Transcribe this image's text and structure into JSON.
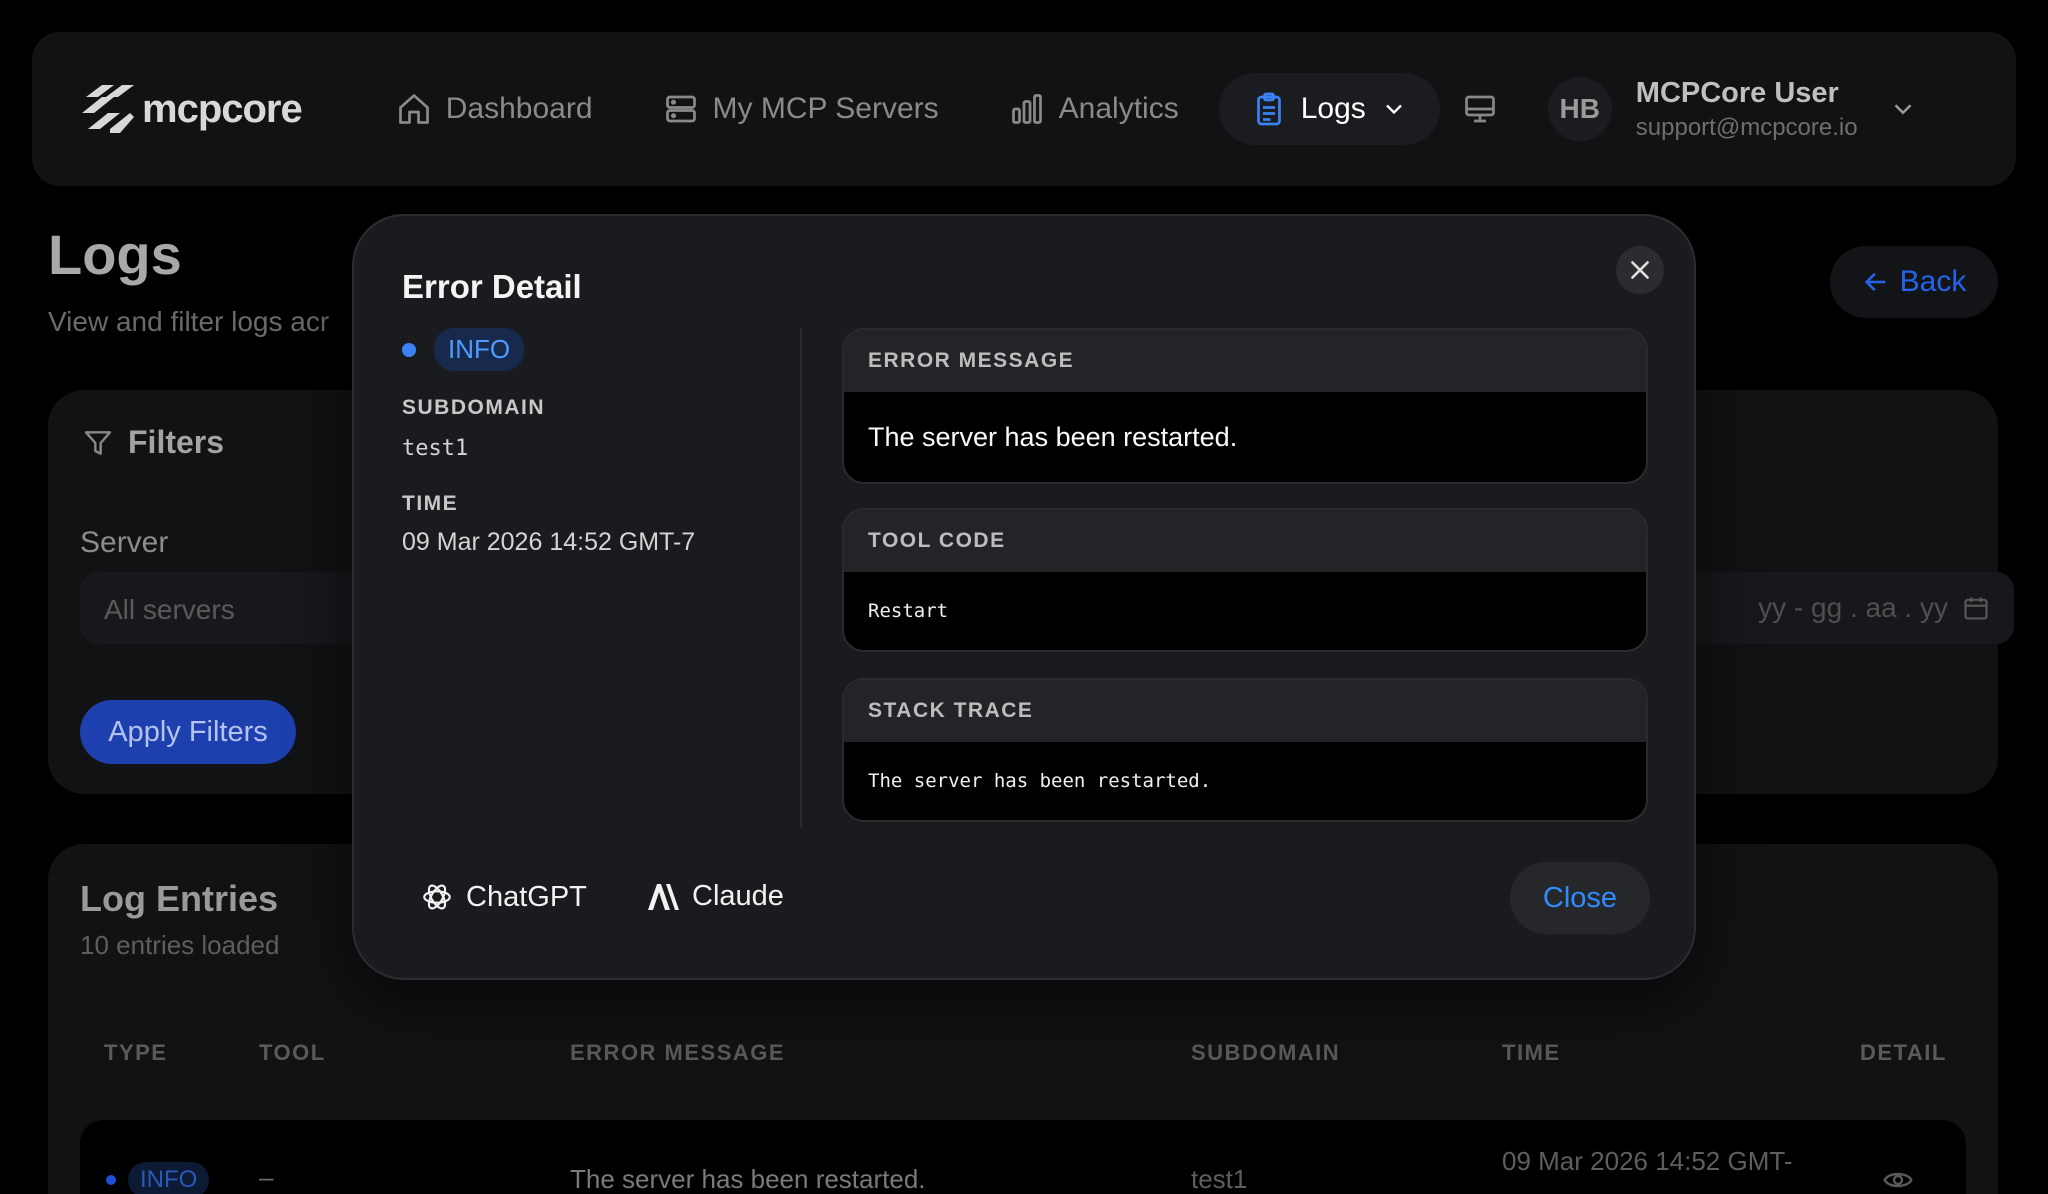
{
  "app": {
    "logo_text": "mcpcore"
  },
  "nav": {
    "dashboard": "Dashboard",
    "servers": "My MCP Servers",
    "analytics": "Analytics",
    "logs": "Logs",
    "avatar_initials": "HB",
    "user_name": "MCPCore User",
    "user_email": "support@mcpcore.io"
  },
  "page": {
    "title": "Logs",
    "subtitle": "View and filter logs acr",
    "back_label": "Back"
  },
  "filters": {
    "title": "Filters",
    "server_label": "Server",
    "server_placeholder": "All servers",
    "date_placeholder": "yy  -  gg . aa . yy",
    "apply_label": "Apply Filters"
  },
  "entries": {
    "title": "Log Entries",
    "count": "10 entries loaded",
    "columns": [
      "TYPE",
      "TOOL",
      "ERROR MESSAGE",
      "SUBDOMAIN",
      "TIME",
      "DETAIL"
    ],
    "rows": [
      {
        "type": "INFO",
        "tool": "–",
        "message": "The server has been restarted.",
        "subdomain": "test1",
        "time": "09 Mar 2026 14:52 GMT-"
      }
    ]
  },
  "modal": {
    "title": "Error Detail",
    "level": "INFO",
    "subdomain_label": "SUBDOMAIN",
    "subdomain_value": "test1",
    "time_label": "TIME",
    "time_value": "09 Mar 2026 14:52 GMT-7",
    "error_message_label": "ERROR MESSAGE",
    "error_message": "The server has been restarted.",
    "tool_code_label": "TOOL CODE",
    "tool_code": "Restart",
    "stack_trace_label": "STACK TRACE",
    "stack_trace": "The server has been restarted.",
    "chatgpt_label": "ChatGPT",
    "claude_label": "Claude",
    "close_label": "Close"
  },
  "colors": {
    "accent": "#3b82f6",
    "background": "#000000",
    "surface": "#1a1b1e"
  }
}
